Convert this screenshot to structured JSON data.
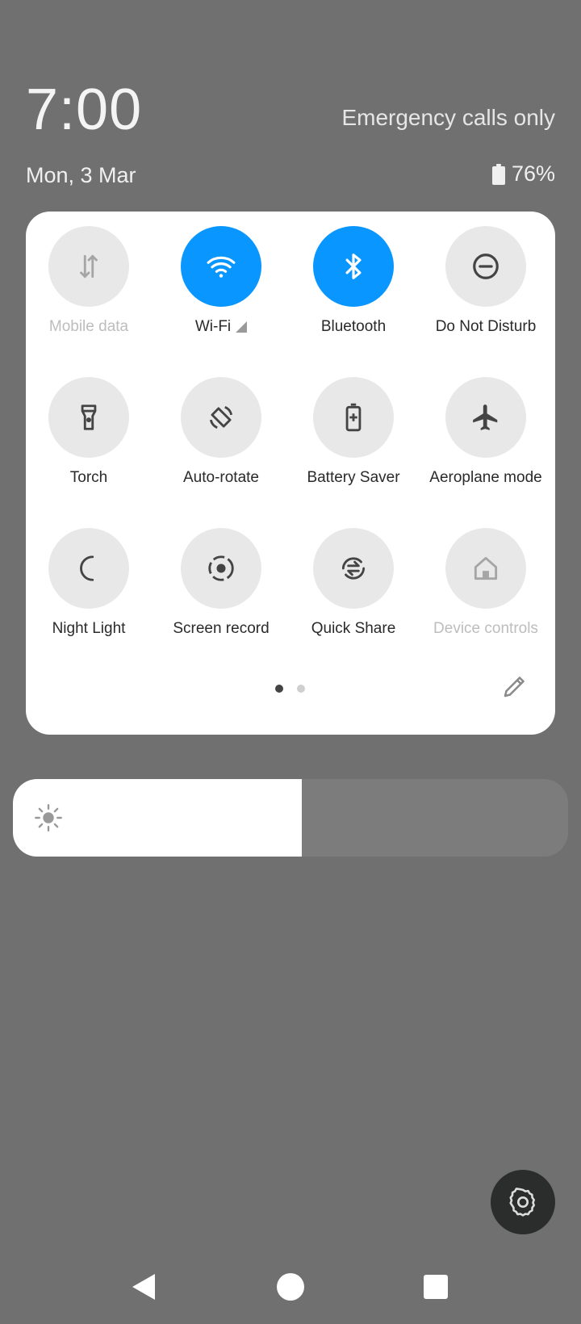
{
  "status": {
    "time": "7:00",
    "date": "Mon, 3 Mar",
    "network_text": "Emergency calls only",
    "battery_percent": "76%"
  },
  "quick_settings": {
    "tiles": [
      {
        "label": "Mobile data",
        "icon": "mobile-data-icon",
        "state": "disabled"
      },
      {
        "label": "Wi-Fi",
        "icon": "wifi-icon",
        "state": "on",
        "extra_icon": "signal-icon"
      },
      {
        "label": "Bluetooth",
        "icon": "bluetooth-icon",
        "state": "on"
      },
      {
        "label": "Do Not Disturb",
        "icon": "do-not-disturb-icon",
        "state": "off"
      },
      {
        "label": "Torch",
        "icon": "torch-icon",
        "state": "off"
      },
      {
        "label": "Auto-rotate",
        "icon": "auto-rotate-icon",
        "state": "off"
      },
      {
        "label": "Battery Saver",
        "icon": "battery-saver-icon",
        "state": "off"
      },
      {
        "label": "Aeroplane mode",
        "icon": "aeroplane-icon",
        "state": "off"
      },
      {
        "label": "Night Light",
        "icon": "night-light-icon",
        "state": "off"
      },
      {
        "label": "Screen record",
        "icon": "screen-record-icon",
        "state": "off"
      },
      {
        "label": "Quick Share",
        "icon": "quick-share-icon",
        "state": "off"
      },
      {
        "label": "Device controls",
        "icon": "device-controls-icon",
        "state": "disabled"
      }
    ],
    "page_count": 2,
    "current_page": 1
  },
  "brightness": {
    "level_fraction": 0.52,
    "icon": "brightness-sun-icon"
  },
  "colors": {
    "accent": "#0a96ff",
    "scrim": "#707070",
    "tile_off": "#e8e8e8",
    "panel": "#ffffff",
    "fab": "#2b2d2d"
  },
  "navigation": {
    "buttons": [
      "back-icon",
      "home-icon",
      "recents-icon"
    ]
  }
}
